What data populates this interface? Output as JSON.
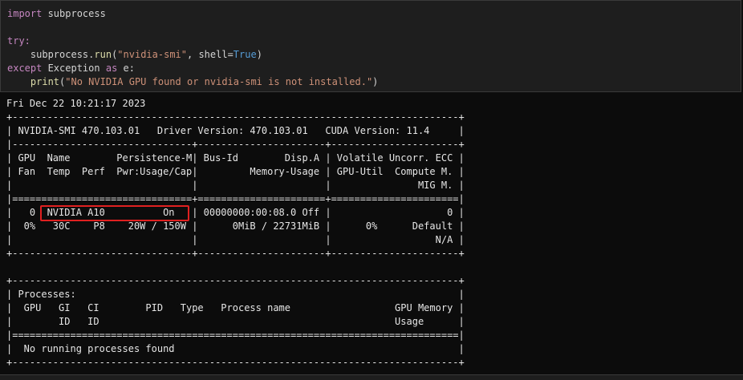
{
  "code": {
    "import_kw": "import",
    "import_mod": " subprocess",
    "try_kw": "try:",
    "run_prefix": "    subprocess.",
    "run_fn": "run",
    "run_paren": "(",
    "run_str": "\"nvidia-smi\"",
    "run_mid": ", shell=",
    "run_true": "True",
    "run_close": ")",
    "except_kw": "except",
    "except_mid": " Exception ",
    "as_kw": "as",
    "except_end": " e:",
    "print_indent": "    ",
    "print_fn": "print",
    "print_open": "(",
    "print_str": "\"No NVIDIA GPU found or nvidia-smi is not installed.\"",
    "print_close": ")"
  },
  "output": {
    "lines": [
      "Fri Dec 22 10:21:17 2023",
      "+-----------------------------------------------------------------------------+",
      "| NVIDIA-SMI 470.103.01   Driver Version: 470.103.01   CUDA Version: 11.4     |",
      "|-------------------------------+----------------------+----------------------+",
      "| GPU  Name        Persistence-M| Bus-Id        Disp.A | Volatile Uncorr. ECC |",
      "| Fan  Temp  Perf  Pwr:Usage/Cap|         Memory-Usage | GPU-Util  Compute M. |",
      "|                               |                      |               MIG M. |",
      "|===============================+======================+======================|",
      "|   0  NVIDIA A10          On   | 00000000:00:08.0 Off |                    0 |",
      "|  0%   30C    P8    20W / 150W |      0MiB / 22731MiB |      0%      Default |",
      "|                               |                      |                  N/A |",
      "+-------------------------------+----------------------+----------------------+",
      "",
      "+-----------------------------------------------------------------------------+",
      "| Processes:                                                                  |",
      "|  GPU   GI   CI        PID   Type   Process name                  GPU Memory |",
      "|        ID   ID                                                   Usage      |",
      "|=============================================================================|",
      "|  No running processes found                                                 |",
      "+-----------------------------------------------------------------------------+"
    ]
  }
}
